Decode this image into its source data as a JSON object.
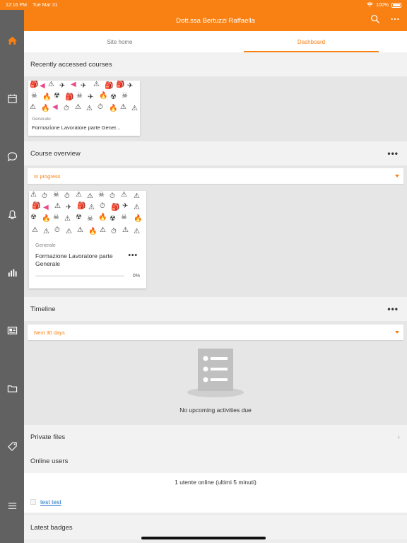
{
  "statusbar": {
    "time": "12:16 PM",
    "date": "Tue Mar 31",
    "battery": "100%"
  },
  "header": {
    "title": "Dott.ssa Bertuzzi Raffaella"
  },
  "tabs": [
    {
      "label": "Site home"
    },
    {
      "label": "Dashboard"
    }
  ],
  "recent": {
    "heading": "Recently accessed courses",
    "course": {
      "category": "Generale",
      "name": "Formazione Lavoratore parte Gener..."
    }
  },
  "overview": {
    "heading": "Course overview",
    "filter": "In progress",
    "course": {
      "category": "Generale",
      "name": "Formazione Lavoratore parte Generale",
      "progress_label": "0%",
      "progress": 0
    }
  },
  "timeline": {
    "heading": "Timeline",
    "filter": "Next 30 days",
    "empty": "No upcoming activities due"
  },
  "private_files": {
    "heading": "Private files"
  },
  "online_users": {
    "heading": "Online users",
    "count_text": "1 utente online (ultimi 5 minuti)",
    "users": [
      "test test"
    ]
  },
  "badges": {
    "heading": "Latest badges"
  },
  "colors": {
    "accent": "#f98012",
    "sidebar": "#616161",
    "link": "#1a6fc3"
  },
  "sidebar_icons": [
    "home-icon",
    "calendar-icon",
    "chat-icon",
    "bell-icon",
    "grades-icon",
    "news-icon",
    "folder-icon",
    "tag-icon",
    "menu-icon"
  ]
}
